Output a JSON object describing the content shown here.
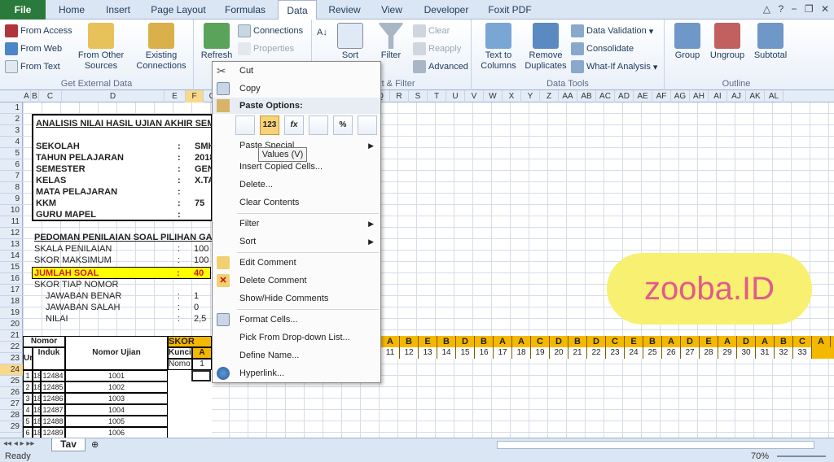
{
  "tabs": [
    "File",
    "Home",
    "Insert",
    "Page Layout",
    "Formulas",
    "Data",
    "Review",
    "View",
    "Developer",
    "Foxit PDF"
  ],
  "ribbon": {
    "get_external": {
      "from_access": "From Access",
      "from_web": "From Web",
      "from_text": "From Text",
      "from_other": "From Other",
      "sources": "Sources",
      "existing": "Existing",
      "connections_word": "Connections",
      "label": "Get External Data"
    },
    "connections": {
      "refresh": "Refresh",
      "all": "All",
      "connections": "Connections",
      "properties": "Properties"
    },
    "sort": {
      "sort": "Sort",
      "filter": "Filter",
      "clear": "Clear",
      "reapply": "Reapply",
      "advanced": "Advanced",
      "label": "Sort & Filter"
    },
    "tools": {
      "text_to": "Text to",
      "columns": "Columns",
      "remove": "Remove",
      "duplicates": "Duplicates",
      "validation": "Data Validation",
      "consolidate": "Consolidate",
      "whatif": "What-If Analysis",
      "label": "Data Tools"
    },
    "outline": {
      "group": "Group",
      "ungroup": "Ungroup",
      "subtotal": "Subtotal",
      "label": "Outline"
    }
  },
  "columns": [
    "A",
    "B",
    "C",
    "D",
    "E",
    "F",
    "G",
    "",
    "",
    "",
    "",
    "",
    "",
    "",
    "P",
    "Q",
    "R",
    "S",
    "T",
    "U",
    "V",
    "W",
    "X",
    "Y",
    "Z",
    "AA",
    "AB",
    "AC",
    "AD",
    "AE",
    "AF",
    "AG",
    "AH",
    "AI",
    "AJ",
    "AK",
    "AL"
  ],
  "rows": [
    "1",
    "2",
    "3",
    "4",
    "5",
    "6",
    "7",
    "8",
    "9",
    "10",
    "11",
    "12",
    "13",
    "14",
    "15",
    "16",
    "17",
    "18",
    "19",
    "20",
    "21",
    "22",
    "23",
    "24",
    "25",
    "26",
    "27",
    "28",
    "29"
  ],
  "sheet": {
    "title": "ANALISIS NILAI HASIL UJIAN AKHIR SEME",
    "sekolah": "SEKOLAH",
    "sekolah_val": "SMK",
    "tahun": "TAHUN PELAJARAN",
    "tahun_val": "2018",
    "semester": "SEMESTER",
    "semester_val": "GEN",
    "kelas": "KELAS",
    "kelas_val": "X.TA",
    "mapel": "MATA PELAJARAN",
    "kkm": "KKM",
    "kkm_val": "75",
    "guru": "GURU MAPEL",
    "colon": ":",
    "pedoman": "PEDOMAN PENILAIAN SOAL PILIHAN GA",
    "skala": "SKALA PENILAIAN",
    "skala_val": "100",
    "skor_max": "SKOR MAKSIMUM",
    "skor_max_val": "100",
    "jumlah": "JUMLAH SOAL",
    "jumlah_val": "40",
    "skor_tiap": "SKOR TIAP NOMOR",
    "benar": "JAWABAN BENAR",
    "benar_val": "1",
    "salah": "JAWABAN SALAH",
    "salah_val": "0",
    "nilai": "NILAI",
    "nilai_val": "2,5",
    "nomor": "Nomor",
    "urt": "Urt",
    "induk": "Induk",
    "nomor_ujian": "Nomor Ujian",
    "skor_tia": "SKOR TIA",
    "kunci": "Kunci",
    "nomo": "Nomo",
    "a": "A",
    "one": "1",
    "answers": [
      "A",
      "B",
      "E",
      "B",
      "D",
      "B",
      "A",
      "A",
      "C",
      "D",
      "B",
      "D",
      "C",
      "E",
      "B",
      "A",
      "D",
      "E",
      "A",
      "D",
      "A",
      "B",
      "C",
      "A"
    ],
    "numbers": [
      "11",
      "12",
      "13",
      "14",
      "15",
      "16",
      "17",
      "18",
      "19",
      "20",
      "21",
      "22",
      "23",
      "24",
      "25",
      "26",
      "27",
      "28",
      "29",
      "30",
      "31",
      "32",
      "33"
    ],
    "students": [
      {
        "u": "1",
        "i": "18",
        "ind": "12484",
        "nu": "1001"
      },
      {
        "u": "2",
        "i": "18",
        "ind": "12485",
        "nu": "1002"
      },
      {
        "u": "3",
        "i": "18",
        "ind": "12486",
        "nu": "1003"
      },
      {
        "u": "4",
        "i": "18",
        "ind": "12487",
        "nu": "1004"
      },
      {
        "u": "5",
        "i": "18",
        "ind": "12488",
        "nu": "1005"
      },
      {
        "u": "6",
        "i": "18",
        "ind": "12489",
        "nu": "1006"
      }
    ]
  },
  "context_menu": {
    "cut": "Cut",
    "copy": "Copy",
    "paste_options": "Paste Options:",
    "paste_icons": [
      "",
      "123",
      "fx",
      "",
      "%",
      ""
    ],
    "paste_special": "Paste Special",
    "insert_copied": "Insert Copied Cells...",
    "delete": "Delete...",
    "clear_contents": "Clear Contents",
    "filter": "Filter",
    "sort": "Sort",
    "edit_comment": "Edit Comment",
    "delete_comment": "Delete Comment",
    "show_hide": "Show/Hide Comments",
    "format_cells": "Format Cells...",
    "pick_list": "Pick From Drop-down List...",
    "define_name": "Define Name...",
    "hyperlink": "Hyperlink..."
  },
  "tooltip": "Values (V)",
  "watermark": "zooba.ID",
  "sheet_tab": "Tav",
  "status": "Ready",
  "zoom": "70%"
}
